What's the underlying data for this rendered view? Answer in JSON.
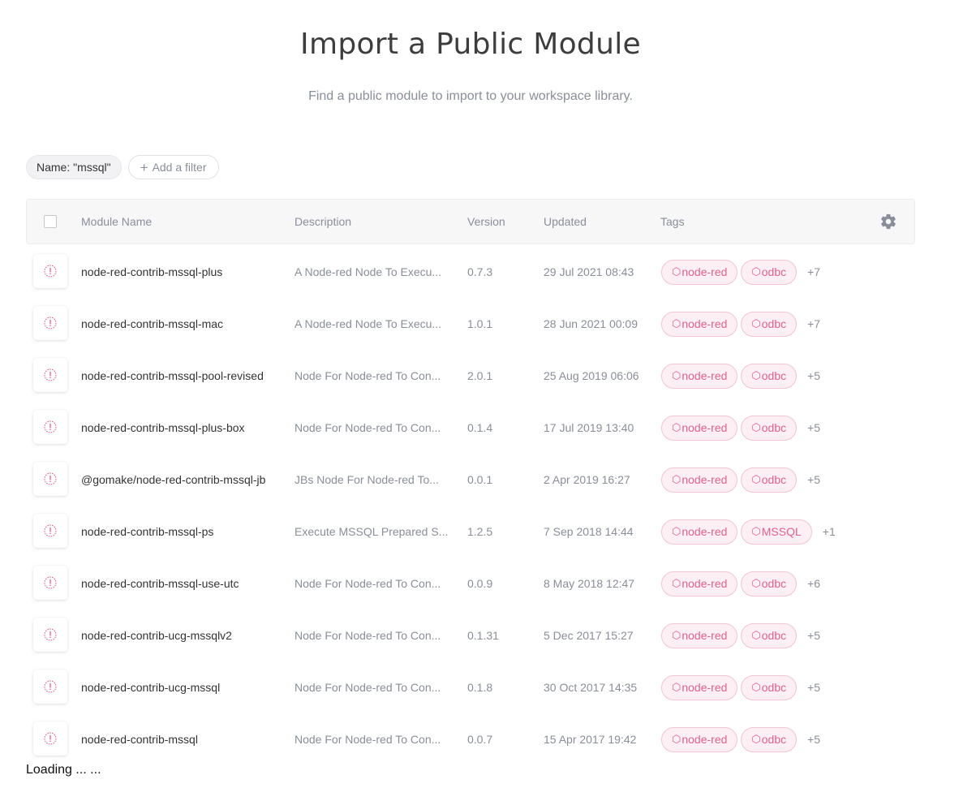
{
  "header": {
    "title": "Import a Public Module",
    "subtitle": "Find a public module to import to your workspace library."
  },
  "filters": {
    "active": "Name: \"mssql\"",
    "add_label": "Add a filter"
  },
  "table": {
    "columns": [
      "Module Name",
      "Description",
      "Version",
      "Updated",
      "Tags"
    ],
    "rows": [
      {
        "name": "node-red-contrib-mssql-plus",
        "description": "A Node-red Node To Execu...",
        "version": "0.7.3",
        "updated": "29 Jul 2021 08:43",
        "tags": [
          "node-red",
          "odbc"
        ],
        "more": "+7"
      },
      {
        "name": "node-red-contrib-mssql-mac",
        "description": "A Node-red Node To Execu...",
        "version": "1.0.1",
        "updated": "28 Jun 2021 00:09",
        "tags": [
          "node-red",
          "odbc"
        ],
        "more": "+7"
      },
      {
        "name": "node-red-contrib-mssql-pool-revised",
        "description": "Node For Node-red To Con...",
        "version": "2.0.1",
        "updated": "25 Aug 2019 06:06",
        "tags": [
          "node-red",
          "odbc"
        ],
        "more": "+5"
      },
      {
        "name": "node-red-contrib-mssql-plus-box",
        "description": "Node For Node-red To Con...",
        "version": "0.1.4",
        "updated": "17 Jul 2019 13:40",
        "tags": [
          "node-red",
          "odbc"
        ],
        "more": "+5"
      },
      {
        "name": "@gomake/node-red-contrib-mssql-jb",
        "description": "JBs Node For Node-red To...",
        "version": "0.0.1",
        "updated": "2 Apr 2019 16:27",
        "tags": [
          "node-red",
          "odbc"
        ],
        "more": "+5"
      },
      {
        "name": "node-red-contrib-mssql-ps",
        "description": "Execute MSSQL Prepared S...",
        "version": "1.2.5",
        "updated": "7 Sep 2018 14:44",
        "tags": [
          "node-red",
          "MSSQL"
        ],
        "more": "+1"
      },
      {
        "name": "node-red-contrib-mssql-use-utc",
        "description": "Node For Node-red To Con...",
        "version": "0.0.9",
        "updated": "8 May 2018 12:47",
        "tags": [
          "node-red",
          "odbc"
        ],
        "more": "+6"
      },
      {
        "name": "node-red-contrib-ucg-mssqlv2",
        "description": "Node For Node-red To Con...",
        "version": "0.1.31",
        "updated": "5 Dec 2017 15:27",
        "tags": [
          "node-red",
          "odbc"
        ],
        "more": "+5"
      },
      {
        "name": "node-red-contrib-ucg-mssql",
        "description": "Node For Node-red To Con...",
        "version": "0.1.8",
        "updated": "30 Oct 2017 14:35",
        "tags": [
          "node-red",
          "odbc"
        ],
        "more": "+5"
      },
      {
        "name": "node-red-contrib-mssql",
        "description": "Node For Node-red To Con...",
        "version": "0.0.7",
        "updated": "15 Apr 2017 19:42",
        "tags": [
          "node-red",
          "odbc"
        ],
        "more": "+5"
      }
    ]
  },
  "icons": {
    "tag": "hexagon-icon",
    "module": "alert-circle-icon",
    "settings": "gear-icon"
  },
  "colors": {
    "tag_text": "#e0638b",
    "tag_bg": "#fdeff3",
    "tag_border": "#f4c4d2"
  },
  "status": {
    "loading": "Loading ... ..."
  }
}
